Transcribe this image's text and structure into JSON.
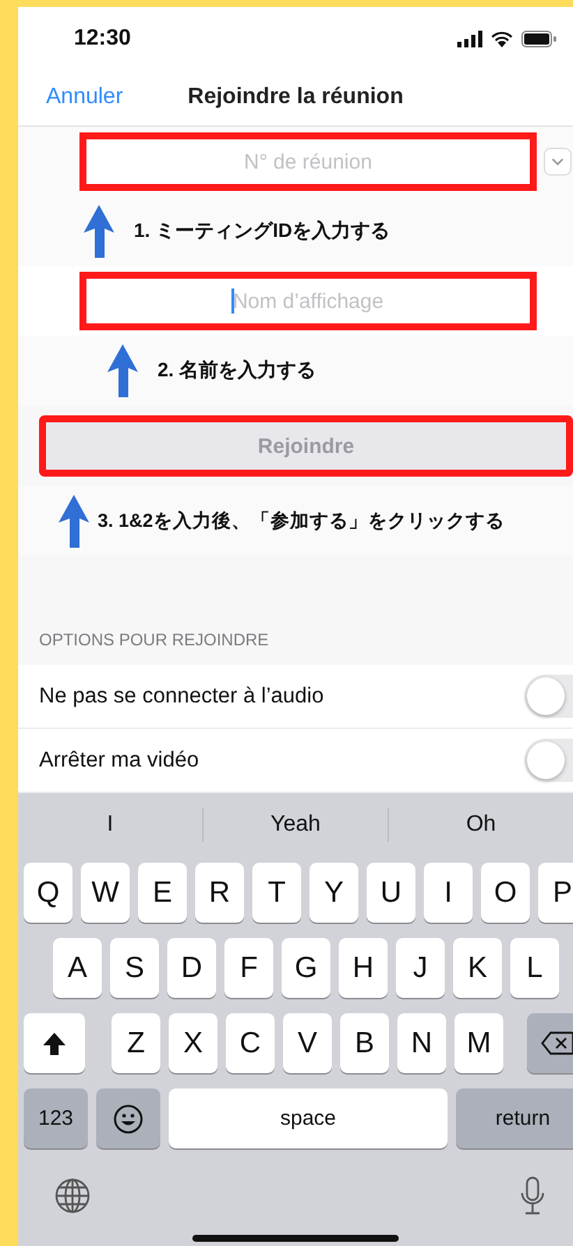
{
  "status_bar": {
    "time": "12:30"
  },
  "nav": {
    "cancel": "Annuler",
    "title": "Rejoindre la réunion"
  },
  "meeting_id_field": {
    "placeholder": "N° de réunion",
    "highlighted": true
  },
  "step_1": "1. ミーティングIDを入力する",
  "name_field": {
    "placeholder": "Nom d’affichage",
    "focused": true,
    "highlighted": true
  },
  "step_2": "2. 名前を入力する",
  "join_button": {
    "label": "Rejoindre",
    "disabled": true,
    "highlighted": true
  },
  "step_3": "3. 1&2を入力後、「参加する」をクリックする",
  "options": {
    "header": "OPTIONS POUR REJOINDRE",
    "items": [
      {
        "label": "Ne pas se connecter à l’audio",
        "on": false
      },
      {
        "label": "Arrêter ma vidéo",
        "on": false
      }
    ]
  },
  "keyboard": {
    "suggestions": [
      "I",
      "Yeah",
      "Oh"
    ],
    "rows": [
      {
        "keys": [
          {
            "kind": "letter",
            "label": "Q"
          },
          {
            "kind": "letter",
            "label": "W"
          },
          {
            "kind": "letter",
            "label": "E"
          },
          {
            "kind": "letter",
            "label": "R"
          },
          {
            "kind": "letter",
            "label": "T"
          },
          {
            "kind": "letter",
            "label": "Y"
          },
          {
            "kind": "letter",
            "label": "U"
          },
          {
            "kind": "letter",
            "label": "I"
          },
          {
            "kind": "letter",
            "label": "O"
          },
          {
            "kind": "letter",
            "label": "P"
          }
        ]
      },
      {
        "keys": [
          {
            "kind": "letter",
            "label": "A"
          },
          {
            "kind": "letter",
            "label": "S"
          },
          {
            "kind": "letter",
            "label": "D"
          },
          {
            "kind": "letter",
            "label": "F"
          },
          {
            "kind": "letter",
            "label": "G"
          },
          {
            "kind": "letter",
            "label": "H"
          },
          {
            "kind": "letter",
            "label": "J"
          },
          {
            "kind": "letter",
            "label": "K"
          },
          {
            "kind": "letter",
            "label": "L"
          }
        ]
      },
      {
        "keys": [
          {
            "kind": "shift"
          },
          {
            "kind": "letter",
            "label": "Z"
          },
          {
            "kind": "letter",
            "label": "X"
          },
          {
            "kind": "letter",
            "label": "C"
          },
          {
            "kind": "letter",
            "label": "V"
          },
          {
            "kind": "letter",
            "label": "B"
          },
          {
            "kind": "letter",
            "label": "N"
          },
          {
            "kind": "letter",
            "label": "M"
          },
          {
            "kind": "backspace"
          }
        ]
      },
      {
        "keys": [
          {
            "kind": "numbers",
            "label": "123"
          },
          {
            "kind": "emoji"
          },
          {
            "kind": "space",
            "label": "space"
          },
          {
            "kind": "return",
            "label": "return"
          }
        ]
      }
    ]
  }
}
